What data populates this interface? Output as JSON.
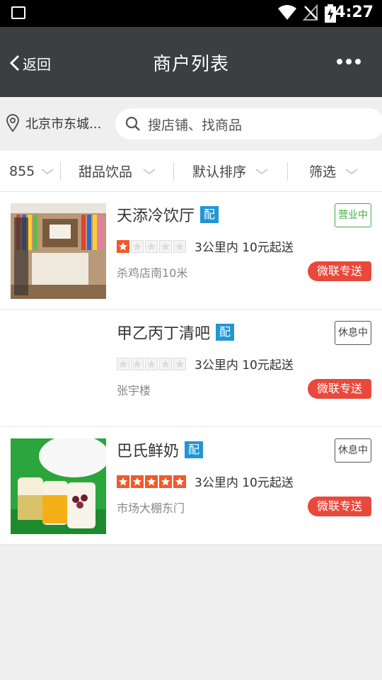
{
  "status_bar": {
    "time": "4:27"
  },
  "header": {
    "back_label": "返回",
    "title": "商户列表"
  },
  "location": {
    "text": "北京市东城..."
  },
  "search": {
    "placeholder": "搜店铺、找商品"
  },
  "filters": [
    {
      "label": "855"
    },
    {
      "label": "甜品饮品"
    },
    {
      "label": "默认排序"
    },
    {
      "label": "筛选"
    }
  ],
  "shop_tag": "配",
  "shops": [
    {
      "name": "天添冷饮厅",
      "status": "营业中",
      "rating": 1,
      "meta": "3公里内 10元起送",
      "address": "杀鸡店南10米",
      "delivery": "微联专送",
      "has_image": true
    },
    {
      "name": "甲乙丙丁清吧",
      "status": "休息中",
      "rating": 0,
      "meta": "3公里内 10元起送",
      "address": "张宇楼",
      "delivery": "微联专送",
      "has_image": false
    },
    {
      "name": "巴氏鲜奶",
      "status": "休息中",
      "rating": 5,
      "meta": "3公里内 10元起送",
      "address": "市场大棚东门",
      "delivery": "微联专送",
      "has_image": true
    }
  ],
  "colors": {
    "header_bg": "#3d3e40",
    "open": "#3cb043",
    "tag_blue": "#2196d3",
    "star_on": "#f05a2a",
    "delivery_red": "#e8493c"
  }
}
